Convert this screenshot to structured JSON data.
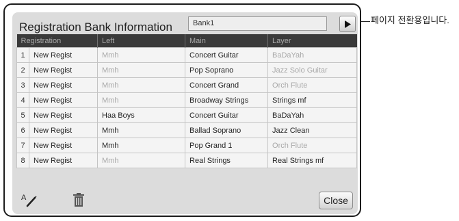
{
  "dialog": {
    "title": "Registration Bank Information",
    "bank_name": "Bank1",
    "columns": [
      "Registration",
      "Left",
      "Main",
      "Layer"
    ],
    "rows": [
      {
        "num": "1",
        "registration": "New Regist",
        "left": "Mmh",
        "left_dimmed": true,
        "main": "Concert Guitar",
        "layer": "BaDaYah",
        "layer_dimmed": true
      },
      {
        "num": "2",
        "registration": "New Regist",
        "left": "Mmh",
        "left_dimmed": true,
        "main": "Pop Soprano",
        "layer": "Jazz Solo Guitar",
        "layer_dimmed": true
      },
      {
        "num": "3",
        "registration": "New Regist",
        "left": "Mmh",
        "left_dimmed": true,
        "main": "Concert Grand",
        "layer": "Orch Flute",
        "layer_dimmed": true
      },
      {
        "num": "4",
        "registration": "New Regist",
        "left": "Mmh",
        "left_dimmed": true,
        "main": "Broadway Strings",
        "layer": "Strings mf",
        "layer_dimmed": false
      },
      {
        "num": "5",
        "registration": "New Regist",
        "left": "Haa Boys",
        "left_dimmed": false,
        "main": "Concert Guitar",
        "layer": "BaDaYah",
        "layer_dimmed": false
      },
      {
        "num": "6",
        "registration": "New Regist",
        "left": "Mmh",
        "left_dimmed": false,
        "main": "Ballad Soprano",
        "layer": "Jazz Clean",
        "layer_dimmed": false
      },
      {
        "num": "7",
        "registration": "New Regist",
        "left": "Mmh",
        "left_dimmed": false,
        "main": "Pop Grand 1",
        "layer": "Orch Flute",
        "layer_dimmed": true
      },
      {
        "num": "8",
        "registration": "New Regist",
        "left": "Mmh",
        "left_dimmed": true,
        "main": "Real Strings",
        "layer": "Real Strings mf",
        "layer_dimmed": false
      }
    ],
    "close_label": "Close",
    "icons": {
      "page": "play-triangle-icon",
      "rename": "rename-icon",
      "delete": "trash-icon"
    }
  },
  "annotation": {
    "text": "페이지 전환용입니다."
  }
}
